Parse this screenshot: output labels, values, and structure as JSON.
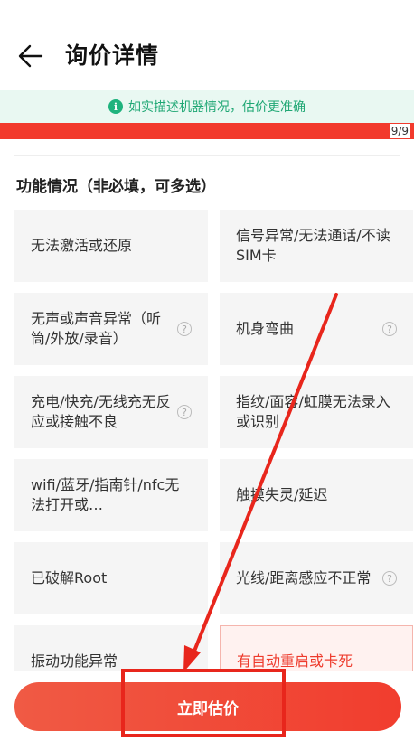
{
  "header": {
    "title": "询价详情",
    "back_icon": "arrow-left-icon"
  },
  "tip": {
    "icon": "info-icon",
    "text": "如实描述机器情况，估价更准确"
  },
  "progress": {
    "label": "9/9",
    "current": 9,
    "total": 9,
    "color": "#f23a2c"
  },
  "section": {
    "title": "功能情况（非必填，可多选）"
  },
  "options": [
    {
      "label": "无法激活或还原",
      "help": false,
      "selected": false
    },
    {
      "label": "信号异常/无法通话/不读SIM卡",
      "help": false,
      "selected": false
    },
    {
      "label": "无声或声音异常（听筒/外放/录音）",
      "help": true,
      "selected": false
    },
    {
      "label": "机身弯曲",
      "help": true,
      "selected": false
    },
    {
      "label": "充电/快充/无线充无反应或接触不良",
      "help": true,
      "selected": false
    },
    {
      "label": "指纹/面容/虹膜无法录入或识别",
      "help": false,
      "selected": false
    },
    {
      "label": "wifi/蓝牙/指南针/nfc无法打开或…",
      "help": false,
      "selected": false
    },
    {
      "label": "触摸失灵/延迟",
      "help": false,
      "selected": false
    },
    {
      "label": "已破解Root",
      "help": false,
      "selected": false
    },
    {
      "label": "光线/距离感应不正常",
      "help": true,
      "selected": false
    },
    {
      "label": "振动功能异常",
      "help": false,
      "selected": false
    },
    {
      "label": "有自动重启或卡死",
      "help": false,
      "selected": true
    }
  ],
  "help_glyph": "?",
  "cta": {
    "label": "立即估价"
  },
  "colors": {
    "accent": "#f13d2e",
    "tip_green": "#1fa774",
    "tip_bg": "#e9f8f2"
  }
}
